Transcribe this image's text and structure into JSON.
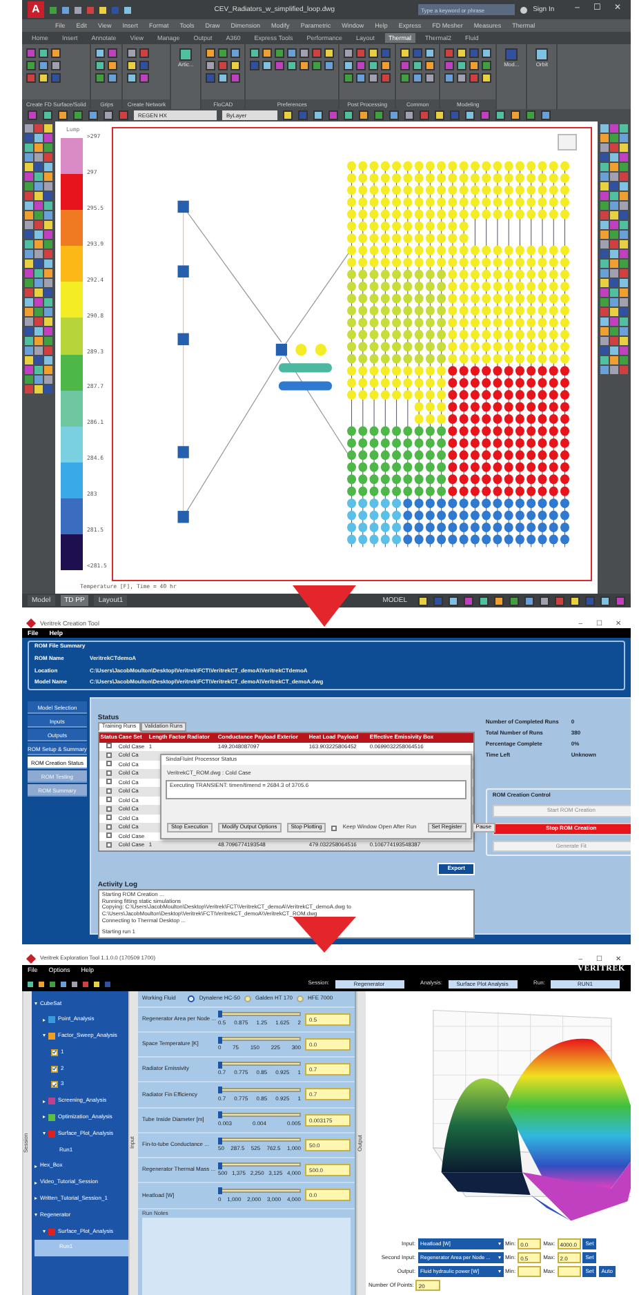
{
  "cad": {
    "logo": "A",
    "title": "CEV_Radiators_w_simplified_loop.dwg",
    "search": {
      "placeholder": "Type a keyword or phrase"
    },
    "sign_in": "Sign In",
    "window_controls": [
      "–",
      "☐",
      "✕"
    ],
    "menu": [
      "File",
      "Edit",
      "View",
      "Insert",
      "Format",
      "Tools",
      "Draw",
      "Dimension",
      "Modify",
      "Parametric",
      "Window",
      "Help",
      "Express",
      "FD Mesher",
      "Measures",
      "Thermal"
    ],
    "ribbon_tabs": [
      {
        "label": "Home",
        "selected": false
      },
      {
        "label": "Insert",
        "selected": false
      },
      {
        "label": "Annotate",
        "selected": false
      },
      {
        "label": "View",
        "selected": false
      },
      {
        "label": "Manage",
        "selected": false
      },
      {
        "label": "Output",
        "selected": false
      },
      {
        "label": "A360",
        "selected": false
      },
      {
        "label": "Express Tools",
        "selected": false
      },
      {
        "label": "Performance",
        "selected": false
      },
      {
        "label": "Layout",
        "selected": false
      },
      {
        "label": "Thermal",
        "selected": true
      },
      {
        "label": "Thermal2",
        "selected": false
      },
      {
        "label": "Fluid",
        "selected": false
      }
    ],
    "ribbon_panels": [
      {
        "label": "Create FD Surface/Solid"
      },
      {
        "label": "Grips"
      },
      {
        "label": "Create Network"
      },
      {
        "button": "Artic..."
      },
      {
        "label": "FloCAD"
      },
      {
        "label": "Preferences"
      },
      {
        "label": "Post Processing"
      },
      {
        "label": "Common"
      },
      {
        "label": "Modeling"
      },
      {
        "button": "Mod..."
      },
      {
        "button": "Orbit"
      }
    ],
    "layer": "REGEN HX",
    "linetype": "ByLayer",
    "legend": {
      "title": "Lump",
      "bins": [
        {
          "color": "#d98bc6"
        },
        {
          "color": "#e8141c"
        },
        {
          "color": "#f07a22"
        },
        {
          "color": "#fbb817"
        },
        {
          "color": "#f4ec25"
        },
        {
          "color": "#b7d43b"
        },
        {
          "color": "#4db848"
        },
        {
          "color": "#6fc7a1"
        },
        {
          "color": "#7ad0e0"
        },
        {
          "color": "#3aa9e8"
        },
        {
          "color": "#3a6dc0"
        },
        {
          "color": "#1e1050"
        }
      ],
      "ticks": [
        ">297",
        "297",
        "295.5",
        "293.9",
        "292.4",
        "290.8",
        "289.3",
        "287.7",
        "286.1",
        "284.6",
        "283",
        "281.5",
        "<281.5"
      ]
    },
    "caption": "Temperature [F], Time = 40 hr",
    "layout_tabs": [
      {
        "label": "Model",
        "selected": false
      },
      {
        "label": "TD PP",
        "selected": true
      },
      {
        "label": "Layout1",
        "selected": false
      }
    ],
    "status_mode": "MODEL"
  },
  "rom": {
    "title": "Veritrek Creation Tool",
    "window_controls": [
      "–",
      "☐",
      "✕"
    ],
    "menu": [
      "File",
      "Help"
    ],
    "summary": {
      "heading": "ROM File Summary",
      "fields": [
        {
          "label": "ROM Name",
          "value": "VeritrekCTdemoA"
        },
        {
          "label": "Location",
          "value": "C:\\Users\\JacobMoulton\\Desktop\\Veritrek\\FCT\\VeritrekCT_demoA\\VeritrekCTdemoA"
        },
        {
          "label": "Model Name",
          "value": "C:\\Users\\JacobMoulton\\Desktop\\Veritrek\\FCT\\VeritrekCT_demoA\\VeritrekCT_demoA.dwg"
        }
      ]
    },
    "nav": [
      {
        "label": "Model Selection",
        "selected": false,
        "disabled": false
      },
      {
        "label": "Inputs",
        "selected": false,
        "disabled": false
      },
      {
        "label": "Outputs",
        "selected": false,
        "disabled": false
      },
      {
        "label": "ROM Setup & Summary",
        "selected": false,
        "disabled": false
      },
      {
        "label": "ROM Creation Status",
        "selected": true,
        "disabled": false
      },
      {
        "label": "ROM Testing",
        "selected": false,
        "disabled": true
      },
      {
        "label": "ROM Summary",
        "selected": false,
        "disabled": true
      }
    ],
    "status_label": "Status",
    "tabs": [
      {
        "label": "Training Runs",
        "selected": true
      },
      {
        "label": "Validation Runs",
        "selected": false
      }
    ],
    "status_column": "Status",
    "columns": [
      "Case Set",
      "Length Factor Radiator",
      "Conductance Payload Exterior",
      "Heat Load Payload",
      "Effective Emissivity Box"
    ],
    "rows": [
      {
        "checked": false,
        "cells": [
          "Cold Case",
          "1",
          "149.2048087097",
          "163.903225806452",
          "0.0699032258064516"
        ]
      },
      {
        "checked": false,
        "cells": [
          "Cold Ca"
        ]
      },
      {
        "checked": false,
        "cells": [
          "Cold Ca"
        ]
      },
      {
        "checked": false,
        "cells": [
          "Cold Ca"
        ]
      },
      {
        "checked": false,
        "cells": [
          "Cold Ca"
        ]
      },
      {
        "checked": false,
        "cells": [
          "Cold Ca"
        ]
      },
      {
        "checked": false,
        "cells": [
          "Cold Ca"
        ]
      },
      {
        "checked": false,
        "cells": [
          "Cold Ca"
        ]
      },
      {
        "checked": false,
        "cells": [
          "Cold Ca"
        ]
      },
      {
        "checked": false,
        "cells": [
          "Cold Ca"
        ]
      },
      {
        "checked": false,
        "cells": [
          "Cold Case"
        ]
      },
      {
        "checked": false,
        "cells": [
          "Cold Case",
          "1",
          "48.7096774193548",
          "479.032258064516",
          "0.106774193548387"
        ]
      }
    ],
    "dialog": {
      "title": "SindaFluint Processor Status",
      "model": "VeritrekCT_ROM.dwg : Cold Case",
      "progress": "Executing TRANSIENT: timen/timend = 2684.3 of 3705.6",
      "buttons": [
        "Stop Execution",
        "Modify Output Options",
        "Stop Plotting"
      ],
      "keep_open": {
        "label": "Keep Window Open After Run",
        "checked": false
      },
      "buttons_right": [
        "Set Register",
        "Pause"
      ]
    },
    "stats": [
      {
        "label": "Number of Completed Runs",
        "value": "0"
      },
      {
        "label": "Total Number of Runs",
        "value": "380"
      },
      {
        "label": "Percentage Complete",
        "value": "0%"
      },
      {
        "label": "Time Left",
        "value": "Unknown"
      }
    ],
    "control": {
      "heading": "ROM Creation Control",
      "buttons": [
        {
          "label": "Start ROM Creation",
          "kind": "normal",
          "disabled": true
        },
        {
          "label": "Stop ROM Creation",
          "kind": "danger",
          "disabled": false
        },
        {
          "label": "Generate Fit",
          "kind": "normal",
          "disabled": true
        }
      ]
    },
    "export": "Export",
    "log_heading": "Activity Log",
    "log": [
      "Starting ROM Creation ...",
      "Running fitting static simulations",
      "Copying: C:\\Users\\JacobMoulton\\Desktop\\Veritrek\\FCT\\VeritrekCT_demoA\\VeritrekCT_demoA.dwg to",
      "C:\\Users\\JacobMoulton\\Desktop\\Veritrek\\FCT\\VeritrekCT_demoA\\VeritrekCT_ROM.dwg",
      "Connecting to Thermal Desktop ...",
      "Starting run 1"
    ]
  },
  "explorer": {
    "title": "Veritrek Exploration Tool 1.1.0.0 (170509 1700)",
    "window_controls": [
      "–",
      "☐",
      "✕"
    ],
    "menu": [
      "File",
      "Options",
      "Help"
    ],
    "logo": "VERITREK",
    "fields": [
      {
        "label": "Session:",
        "value": "Regenerator"
      },
      {
        "label": "Analysis:",
        "value": "Surface Plot Analysis"
      },
      {
        "label": "Run:",
        "value": "RUN1"
      }
    ],
    "side_labels": [
      "Session",
      "Input",
      "Output"
    ],
    "tree": [
      {
        "label": "CubeSat",
        "expanded": true,
        "selected": false,
        "children": [
          {
            "label": "Point_Analysis",
            "expanded": false,
            "selected": false,
            "color": "#3a9ad9"
          },
          {
            "label": "Factor_Sweep_Analysis",
            "expanded": true,
            "selected": false,
            "color": "#f0a020",
            "children": [
              {
                "label": "1",
                "kind": "case",
                "selected": false
              },
              {
                "label": "2",
                "kind": "case",
                "selected": false
              },
              {
                "label": "3",
                "kind": "case",
                "selected": false
              }
            ]
          },
          {
            "label": "Screening_Analysis",
            "expanded": false,
            "selected": false,
            "color": "#c04090"
          },
          {
            "label": "Optimization_Analysis",
            "expanded": false,
            "selected": false,
            "color": "#5cc040"
          },
          {
            "label": "Surface_Plot_Analysis",
            "expanded": true,
            "selected": false,
            "color": "#e02020",
            "children": [
              {
                "label": "Run1",
                "kind": "run",
                "selected": false
              }
            ]
          }
        ]
      },
      {
        "label": "Hex_Box",
        "expanded": false,
        "selected": false
      },
      {
        "label": "Video_Tutorial_Session",
        "expanded": false,
        "selected": false
      },
      {
        "label": "Written_Tutorial_Session_1",
        "expanded": false,
        "selected": false
      },
      {
        "label": "Regenerator",
        "expanded": true,
        "selected": false,
        "children": [
          {
            "label": "Surface_Plot_Analysis",
            "expanded": true,
            "selected": false,
            "color": "#e02020",
            "children": [
              {
                "label": "Run1",
                "kind": "run",
                "selected": true
              }
            ]
          }
        ]
      }
    ],
    "fluid": {
      "label": "Working Fluid",
      "options": [
        {
          "label": "Dynalene HC-50",
          "selected": true
        },
        {
          "label": "Galden HT 170",
          "selected": false
        },
        {
          "label": "HFE 7000",
          "selected": false
        }
      ]
    },
    "sliders": [
      {
        "label": "Regenerator Area per Node ...",
        "ticks": [
          "0.5",
          "0.875",
          "1.25",
          "1.625",
          "2"
        ],
        "level": 0,
        "value": "0.5"
      },
      {
        "label": "Space Temperature [K]",
        "ticks": [
          "0",
          "75",
          "150",
          "225",
          "300"
        ],
        "level": 0,
        "value": "0.0"
      },
      {
        "label": "Radiator Emissivity",
        "ticks": [
          "0.7",
          "0.775",
          "0.85",
          "0.925",
          "1"
        ],
        "level": 0,
        "value": "0.7"
      },
      {
        "label": "Radiator Fin Efficiency",
        "ticks": [
          "0.7",
          "0.775",
          "0.85",
          "0.925",
          "1"
        ],
        "level": 0,
        "value": "0.7"
      },
      {
        "label": "Tube Inside Diameter [m]",
        "ticks": [
          "0.003",
          "0.004",
          "0.005"
        ],
        "level": 0,
        "value": "0.003175"
      },
      {
        "label": "Fin-to-tube Conductance ...",
        "ticks": [
          "50",
          "287.5",
          "525",
          "762.5",
          "1,000"
        ],
        "level": 0,
        "value": "50.0"
      },
      {
        "label": "Regenerator Thermal Mass ...",
        "ticks": [
          "500",
          "1,375",
          "2,250",
          "3,125",
          "4,000"
        ],
        "level": 0,
        "value": "500.0"
      },
      {
        "label": "Heatload [W]",
        "ticks": [
          "0",
          "1,000",
          "2,000",
          "3,000",
          "4,000"
        ],
        "level": 0,
        "value": "0.0"
      }
    ],
    "notes_label": "Run Notes",
    "plot_controls": [
      {
        "label": "Input:",
        "select": "Heatload [W]",
        "min_label": "Min:",
        "min": "0.0",
        "max_label": "Max:",
        "max": "4000.0",
        "buttons": [
          "Set"
        ]
      },
      {
        "label": "Second Input:",
        "select": "Regenerator Area per Node ...",
        "min_label": "Min:",
        "min": "0.5",
        "max_label": "Max:",
        "max": "2.0",
        "buttons": [
          "Set"
        ]
      },
      {
        "label": "Output:",
        "select": "Fluid hydraulic power [W]",
        "min_label": "Min:",
        "max_label": "Max:",
        "buttons": [
          "Set",
          "Auto"
        ]
      }
    ],
    "points": {
      "label": "Number Of Points:",
      "value": "20"
    }
  }
}
